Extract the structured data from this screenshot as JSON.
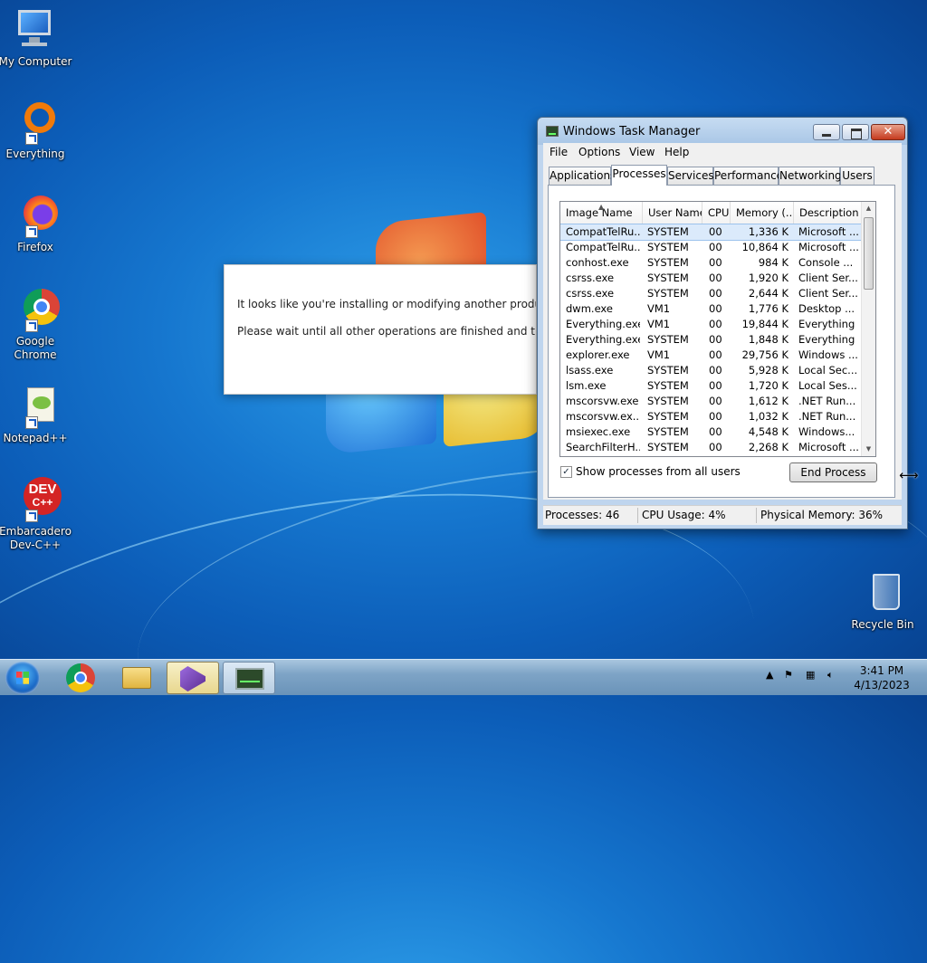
{
  "desktop": {
    "icons": [
      {
        "label": "My Computer"
      },
      {
        "label": "Everything"
      },
      {
        "label": "Firefox"
      },
      {
        "label": "Google Chrome"
      },
      {
        "label": "Notepad++"
      },
      {
        "label": "Embarcadero Dev-C++",
        "logo_text": "DEV",
        "logo_sub": "C++"
      },
      {
        "label": "Recycle Bin"
      }
    ]
  },
  "installer_dialog": {
    "line1": "It looks like you're installing or modifying another product right",
    "line2": "Please wait until all other operations are finished and try again."
  },
  "task_manager": {
    "title": "Windows Task Manager",
    "close_glyph": "✕",
    "menu": [
      "File",
      "Options",
      "View",
      "Help"
    ],
    "tabs": [
      "Applications",
      "Processes",
      "Services",
      "Performance",
      "Networking",
      "Users"
    ],
    "active_tab": "Processes",
    "columns": [
      "Image Name",
      "User Name",
      "CPU",
      "Memory (...",
      "Description"
    ],
    "processes": [
      {
        "name": "CompatTelRu...",
        "user": "SYSTEM",
        "cpu": "00",
        "mem": "1,336 K",
        "desc": "Microsoft ...",
        "selected": true
      },
      {
        "name": "CompatTelRu...",
        "user": "SYSTEM",
        "cpu": "00",
        "mem": "10,864 K",
        "desc": "Microsoft ..."
      },
      {
        "name": "conhost.exe",
        "user": "SYSTEM",
        "cpu": "00",
        "mem": "984 K",
        "desc": "Console ..."
      },
      {
        "name": "csrss.exe",
        "user": "SYSTEM",
        "cpu": "00",
        "mem": "1,920 K",
        "desc": "Client Ser..."
      },
      {
        "name": "csrss.exe",
        "user": "SYSTEM",
        "cpu": "00",
        "mem": "2,644 K",
        "desc": "Client Ser..."
      },
      {
        "name": "dwm.exe",
        "user": "VM1",
        "cpu": "00",
        "mem": "1,776 K",
        "desc": "Desktop ..."
      },
      {
        "name": "Everything.exe",
        "user": "VM1",
        "cpu": "00",
        "mem": "19,844 K",
        "desc": "Everything"
      },
      {
        "name": "Everything.exe",
        "user": "SYSTEM",
        "cpu": "00",
        "mem": "1,848 K",
        "desc": "Everything"
      },
      {
        "name": "explorer.exe",
        "user": "VM1",
        "cpu": "00",
        "mem": "29,756 K",
        "desc": "Windows ..."
      },
      {
        "name": "lsass.exe",
        "user": "SYSTEM",
        "cpu": "00",
        "mem": "5,928 K",
        "desc": "Local Sec..."
      },
      {
        "name": "lsm.exe",
        "user": "SYSTEM",
        "cpu": "00",
        "mem": "1,720 K",
        "desc": "Local Ses..."
      },
      {
        "name": "mscorsvw.exe",
        "user": "SYSTEM",
        "cpu": "00",
        "mem": "1,612 K",
        "desc": ".NET Run..."
      },
      {
        "name": "mscorsvw.ex...",
        "user": "SYSTEM",
        "cpu": "00",
        "mem": "1,032 K",
        "desc": ".NET Run..."
      },
      {
        "name": "msiexec.exe",
        "user": "SYSTEM",
        "cpu": "00",
        "mem": "4,548 K",
        "desc": "Windows..."
      },
      {
        "name": "SearchFilterH...",
        "user": "SYSTEM",
        "cpu": "00",
        "mem": "2,268 K",
        "desc": "Microsoft ..."
      }
    ],
    "show_all_users_label": "Show processes from all users",
    "show_all_users_checked": "✓",
    "end_process_label": "End Process",
    "status": {
      "processes": "Processes: 46",
      "cpu": "CPU Usage: 4%",
      "memory": "Physical Memory: 36%"
    }
  },
  "taskbar": {
    "buttons": [
      {
        "icon": "chrome-icon"
      },
      {
        "icon": "explorer-icon"
      },
      {
        "icon": "visual-studio-installer-icon",
        "state": "active"
      },
      {
        "icon": "task-manager-icon",
        "state": "running"
      }
    ],
    "tray_icons": [
      "show-hidden-icons-chevron",
      "action-center-flag-icon",
      "network-icon",
      "volume-muted-icon"
    ],
    "time": "3:41 PM",
    "date": "4/13/2023"
  }
}
